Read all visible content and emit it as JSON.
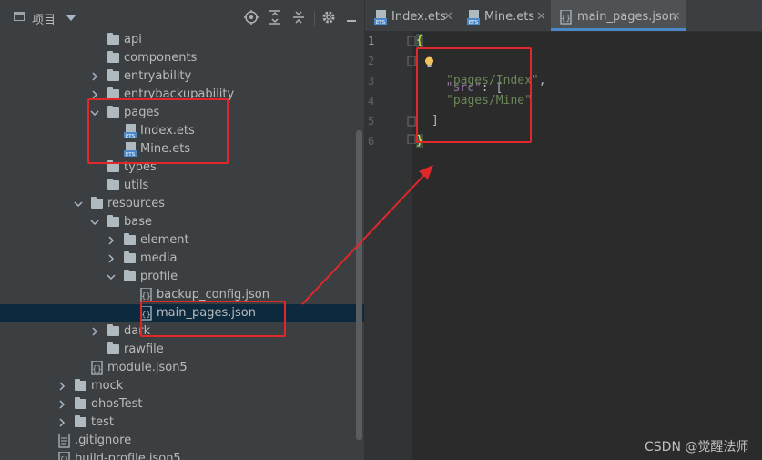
{
  "project_panel": {
    "title": "项目",
    "toolbar_icons": [
      "locate-icon",
      "expand-all-icon",
      "collapse-all-icon",
      "settings-icon",
      "hide-icon"
    ]
  },
  "tree": {
    "api": "api",
    "components": "components",
    "entryability": "entryability",
    "entrybackupability": "entrybackupability",
    "pages": "pages",
    "index_ets": "Index.ets",
    "mine_ets": "Mine.ets",
    "types": "types",
    "utils": "utils",
    "resources": "resources",
    "base": "base",
    "element": "element",
    "media": "media",
    "profile": "profile",
    "backup_config": "backup_config.json",
    "main_pages": "main_pages.json",
    "dark": "dark",
    "rawfile": "rawfile",
    "module_json5": "module.json5",
    "mock": "mock",
    "ohos_test": "ohosTest",
    "test": "test",
    "gitignore": ".gitignore",
    "build_profile": "build-profile.json5"
  },
  "tabs": [
    {
      "label": "Index.ets",
      "close": "✕"
    },
    {
      "label": "Mine.ets",
      "close": "✕"
    },
    {
      "label": "main_pages.json",
      "close": "✕"
    }
  ],
  "editor": {
    "line_numbers": [
      "1",
      "2",
      "3",
      "4",
      "5",
      "6"
    ],
    "brace_open": "{",
    "key": "\"src\"",
    "colon_bracket": ": [",
    "item1": "\"pages/Index\"",
    "comma": ",",
    "item2": "\"pages/Mine\"",
    "bracket_close": "]",
    "brace_close": "}"
  },
  "watermark": "CSDN @觉醒法师",
  "colors": {
    "highlight_box": "#e0282a",
    "selection": "#0d293e",
    "tab_underline": "#4a88c7"
  }
}
